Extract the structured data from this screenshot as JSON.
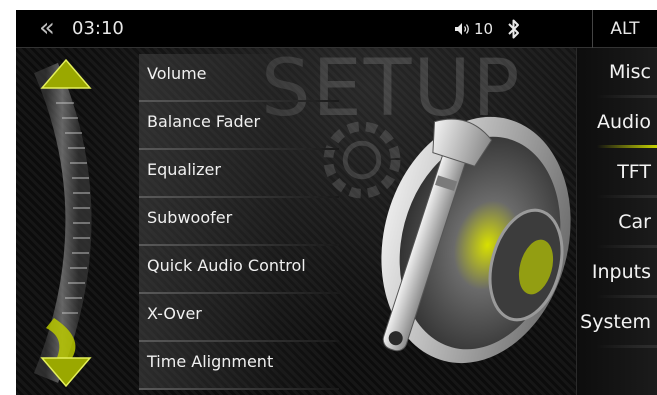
{
  "statusbar": {
    "back_icon": "double-chevron-left-icon",
    "time": "03:10",
    "volume_icon": "speaker-volume-icon",
    "volume_level": "10",
    "bluetooth_icon": "bluetooth-icon",
    "alt_label": "ALT"
  },
  "background": {
    "watermark": "SETUP"
  },
  "menu": {
    "items": [
      {
        "label": "Volume"
      },
      {
        "label": "Balance Fader"
      },
      {
        "label": "Equalizer"
      },
      {
        "label": "Subwoofer"
      },
      {
        "label": "Quick Audio Control"
      },
      {
        "label": "X-Over"
      },
      {
        "label": "Time Alignment"
      }
    ]
  },
  "tabs": {
    "items": [
      {
        "label": "Misc"
      },
      {
        "label": "Audio",
        "active": true
      },
      {
        "label": "TFT"
      },
      {
        "label": "Car"
      },
      {
        "label": "Inputs"
      },
      {
        "label": "System"
      }
    ]
  },
  "colors": {
    "accent": "#c8d400",
    "background": "#0e0e0e",
    "text": "#f0f0f0"
  }
}
